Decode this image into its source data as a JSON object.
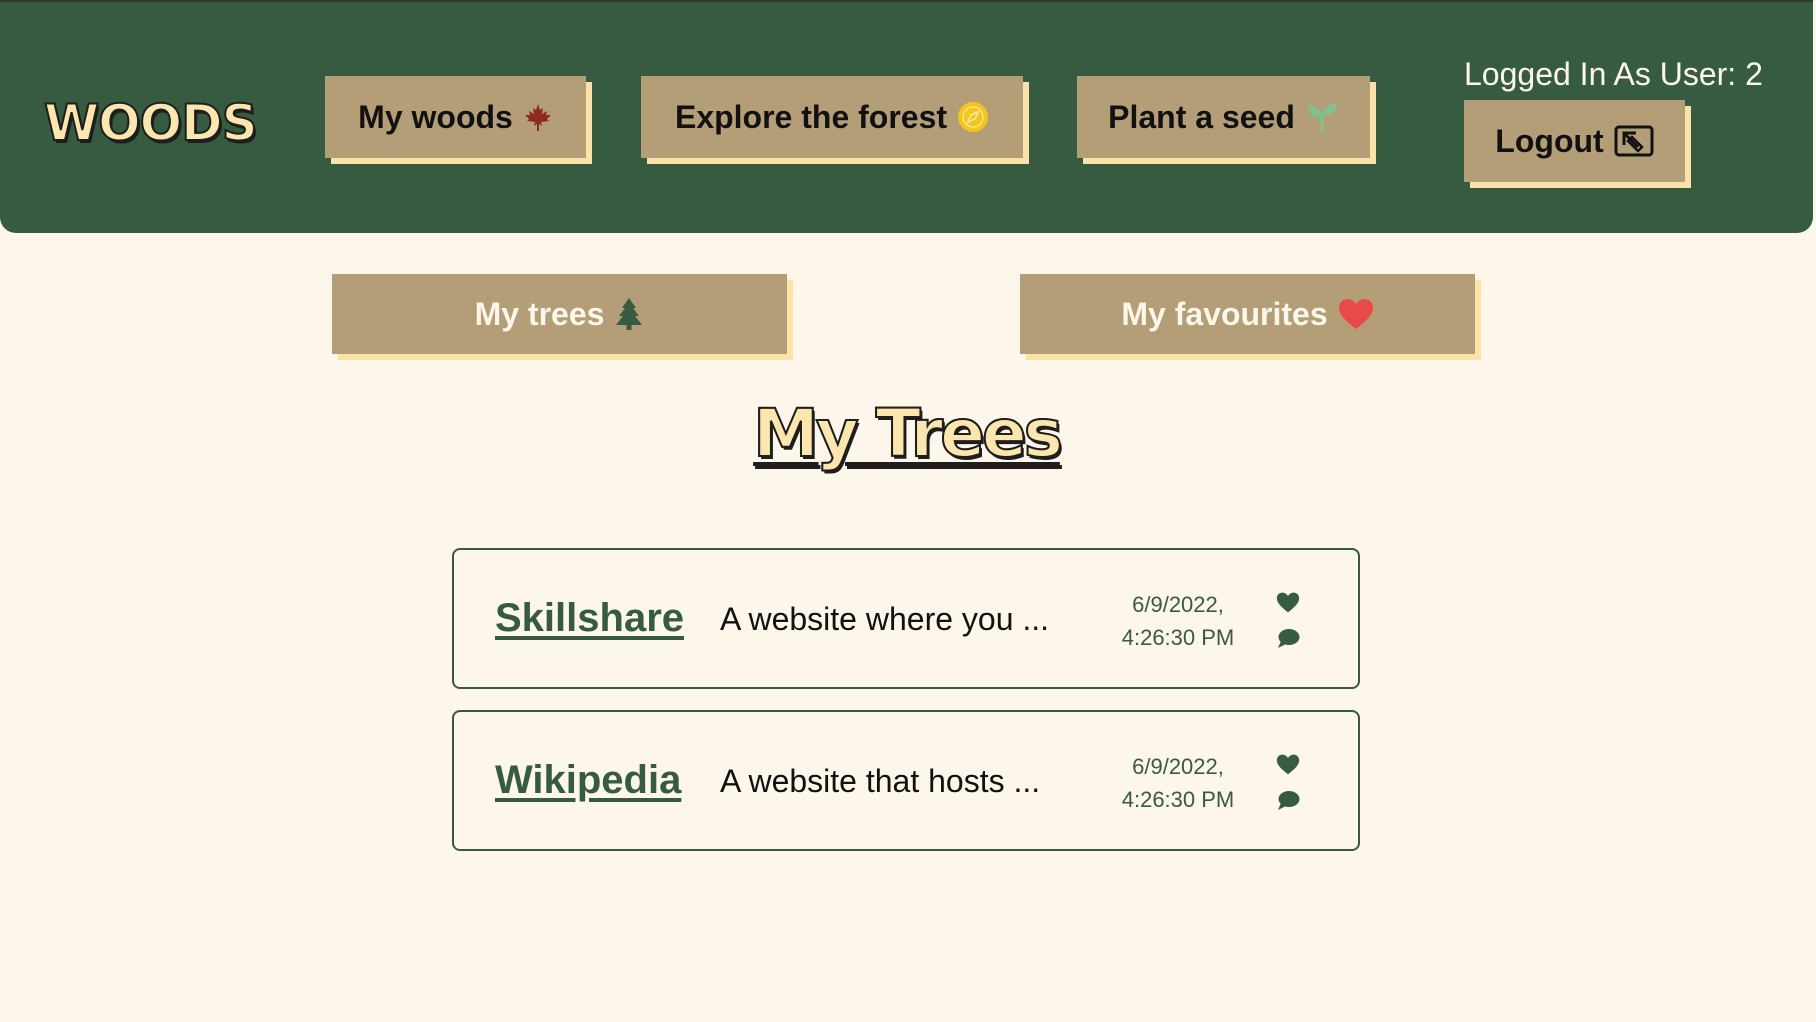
{
  "header": {
    "logo": "WOODS",
    "nav": [
      {
        "label": "My woods",
        "icon": "maple-leaf-icon"
      },
      {
        "label": "Explore the forest",
        "icon": "compass-icon"
      },
      {
        "label": "Plant a seed",
        "icon": "seedling-icon"
      }
    ],
    "user_label": "Logged In As User: 2",
    "logout": {
      "label": "Logout",
      "icon": "logout-icon"
    }
  },
  "tabs": [
    {
      "label": "My trees",
      "icon": "tree-icon"
    },
    {
      "label": "My favourites",
      "icon": "heart-icon"
    }
  ],
  "title": "My Trees",
  "trees": [
    {
      "name": "Skillshare",
      "description": "A website where you ...",
      "date_line1": "6/9/2022,",
      "date_line2": "4:26:30 PM",
      "actions": [
        "heart-icon",
        "comment-icon"
      ]
    },
    {
      "name": "Wikipedia",
      "description": "A website that hosts ...",
      "date_line1": "6/9/2022,",
      "date_line2": "4:26:30 PM",
      "actions": [
        "heart-icon",
        "comment-icon"
      ]
    }
  ],
  "colors": {
    "header_bg": "#375b41",
    "page_bg": "#fdf6ea",
    "button_bg": "#b49e77",
    "button_shadow": "#fbe2a9",
    "accent_green": "#375b41",
    "heart_red": "#e84a4a"
  }
}
